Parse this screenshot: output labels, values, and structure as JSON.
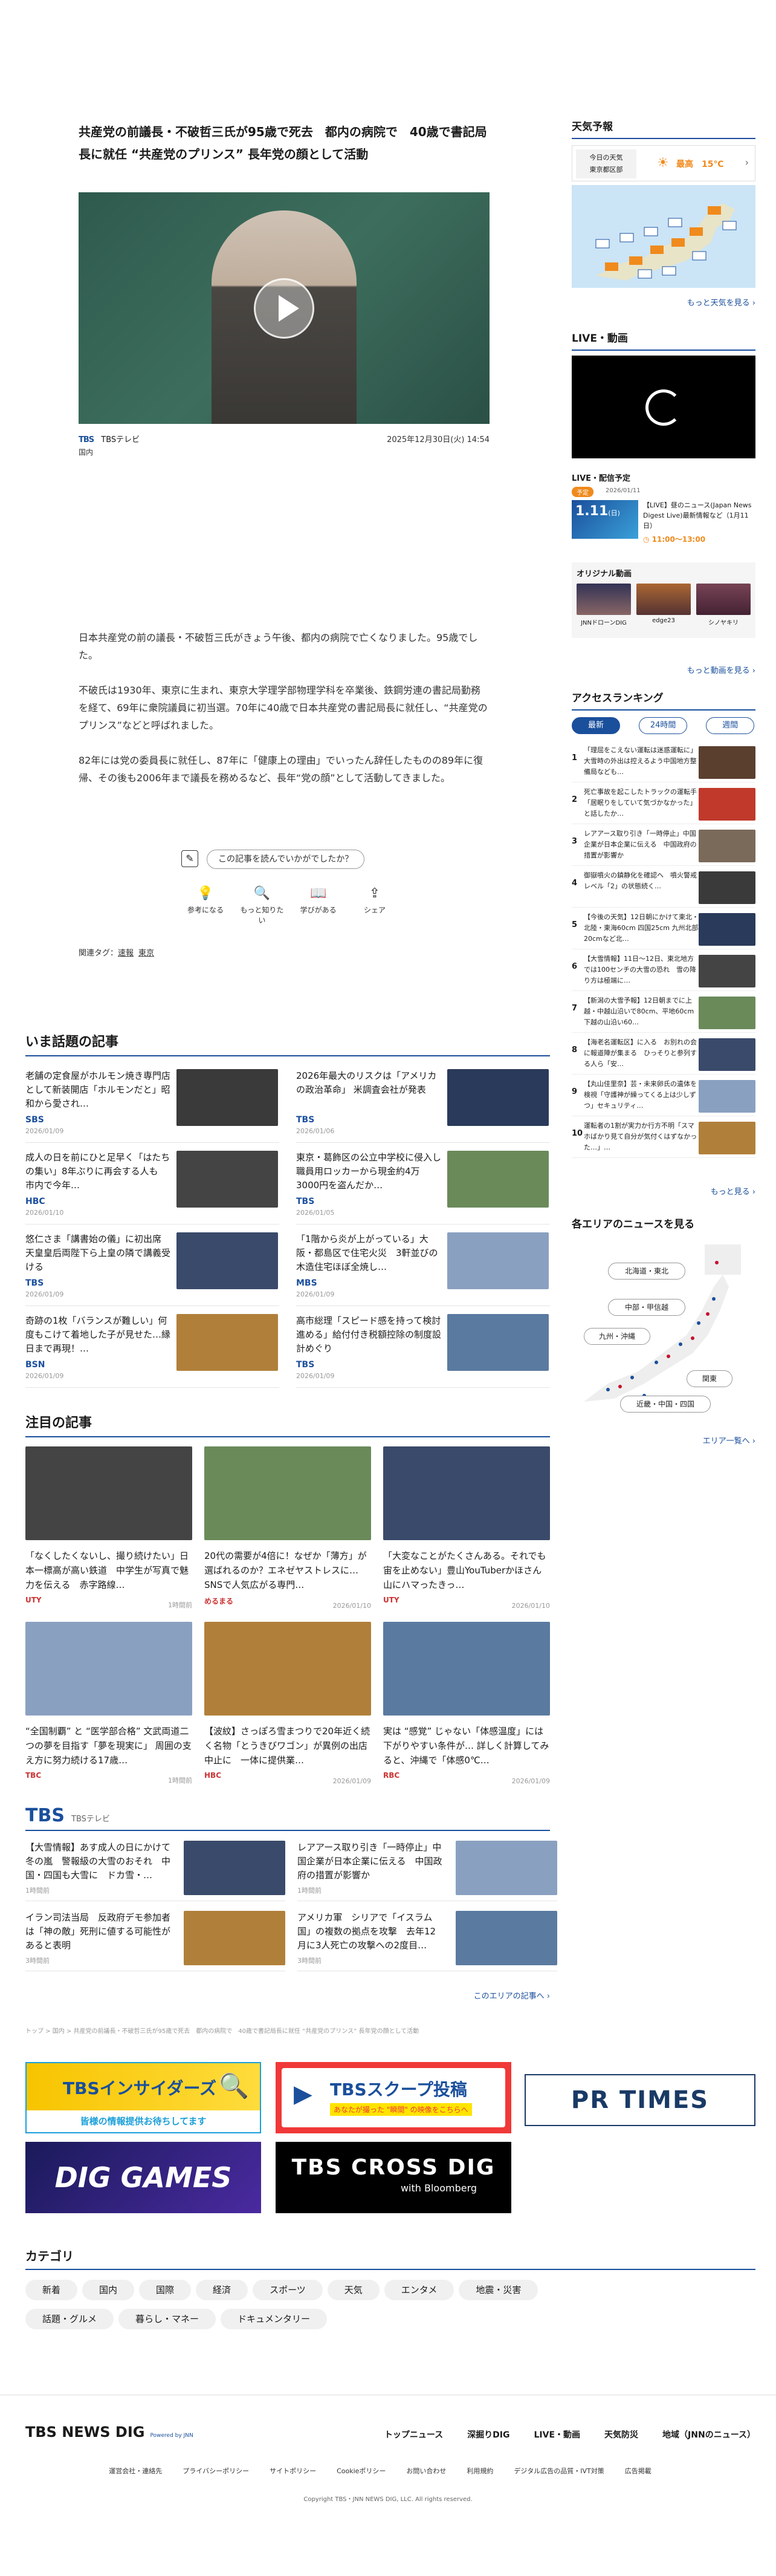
{
  "article": {
    "title": "共産党の前議長・不破哲三氏が95歳で死去　都内の病院で　40歳で書記局長に就任 “共産党のプリンス” 長年党の顔として活動",
    "source_logo": "TBS",
    "source_name": "TBSテレビ",
    "category": "国内",
    "date": "2025年12月30日(火) 14:54",
    "paragraphs": [
      "日本共産党の前の議長・不破哲三氏がきょう午後、都内の病院で亡くなりました。95歳でした。",
      "不破氏は1930年、東京に生まれ、東京大学理学部物理学科を卒業後、鉄鋼労連の書記局勤務を経て、69年に衆院議員に初当選。70年に40歳で日本共産党の書記局長に就任し、“共産党のプリンス”などと呼ばれました。",
      "82年には党の委員長に就任し、87年に「健康上の理由」でいったん辞任したものの89年に復帰、その後も2006年まで議長を務めるなど、長年“党の顔”として活動してきました。"
    ],
    "feedback_prompt": "この記事を読んでいかがでしたか？",
    "reactions": [
      "参考になる",
      "もっと知りたい",
      "学びがある",
      "シェア"
    ],
    "tags_label": "関連タグ：",
    "tags": [
      "速報",
      "東京"
    ]
  },
  "sidebar": {
    "weather_title": "天気予報",
    "weather_today": "今日の天気",
    "weather_area": "東京都区部",
    "weather_high": "最高　15℃",
    "weather_more": "もっと天気を見る",
    "live_title": "LIVE・動画",
    "live_schedule_title": "LIVE・配信予定",
    "live_badge": "予定",
    "live_date_small": "2026/01/11",
    "live_date": "1.11",
    "live_day": "(日)",
    "live_item_title": "【LIVE】昼のニュース(Japan News Digest Live)最新情報など（1月11日）",
    "live_time": "11:00～13:00",
    "original_title": "オリジナル動画",
    "original_items": [
      "JNNドローンDIG",
      "edge23",
      "シノヤキリ"
    ],
    "original_more": "もっと動画を見る",
    "ranking_title": "アクセスランキング",
    "ranking_tabs": [
      "最新",
      "24時間",
      "週間"
    ],
    "ranking": [
      "「理屈をこえない運転は迷惑運転に」大雪時の外出は控えるよう中国地方整備局なども…",
      "死亡事故を起こしたトラックの運転手「居眠りをしていて気づかなかった」と話したか…",
      "レアアース取り引き「一時停止」中国企業が日本企業に伝える　中国政府の措置が影響か",
      "御嶽噴火の鎮静化を確認へ　噴火警戒レベル「2」の状態続く…",
      "【今後の天気】12日朝にかけて東北・北陸・東海60cm 四国25cm 九州北部20cmなど北…",
      "【大雪情報】11日～12日、東北地方では100センチの大雪の恐れ　雪の降り方は極端に…",
      "【新潟の大雪予報】12日朝までに上越・中越山沿いで80cm、平地60cm 下越の山沿い60…",
      "【海老名運転区】に入る　お別れの会に報道陣が集まる　ひっそりと参列する人ら「安…",
      "【丸山佳里奈】芸・未来卵氏の遺体を検視「守護神が繰ってくる上は少しずつ」セキュリティ…",
      "運転者の1割が実力か行方不明「スマホばかり見て自分が気付くはずなかった…」…"
    ],
    "ranking_more": "もっと見る",
    "area_title": "各エリアのニュースを見る",
    "areas": [
      "北海道・東北",
      "中部・甲信越",
      "九州・沖縄",
      "関東",
      "近畿・中国・四国"
    ],
    "area_more": "エリア一覧へ"
  },
  "topics": {
    "title": "いま話題の記事",
    "items": [
      {
        "title": "老舗の定食屋がホルモン焼き専門店として新装開店「ホルモンだと」昭和から愛され…",
        "source": "SBS",
        "date": "2026/01/09"
      },
      {
        "title": "2026年最大のリスクは「アメリカの政治革命」 米調査会社が発表",
        "source": "TBS",
        "date": "2026/01/06"
      },
      {
        "title": "成人の日を前にひと足早く「はたちの集い」8年ぶりに再会する人も　市内で今年…",
        "source": "HBC",
        "date": "2026/01/10"
      },
      {
        "title": "東京・葛飾区の公立中学校に侵入し職員用ロッカーから現金約4万3000円を盗んだか…",
        "source": "TBS",
        "date": "2026/01/05"
      },
      {
        "title": "悠仁さま「講書始の儀」に初出席　天皇皇后両陛下ら上皇の隣で講義受ける",
        "source": "TBS",
        "date": "2026/01/09"
      },
      {
        "title": "「1階から炎が上がっている」大阪・都島区で住宅火災　3軒並びの木造住宅ほぼ全焼し…",
        "source": "MBS",
        "date": "2026/01/09"
      },
      {
        "title": "奇跡の1枚「バランスが難しい」何度もこけて着地した子が見せた…縁日まで再現！…",
        "source": "BSN",
        "date": "2026/01/09"
      },
      {
        "title": "高市総理「スピード感を持って検討進める」給付付き税額控除の制度設計めぐり",
        "source": "TBS",
        "date": "2026/01/09"
      }
    ]
  },
  "featured": {
    "title": "注目の記事",
    "items": [
      {
        "title": "「なくしたくないし、撮り続けたい」日本一標高が高い鉄道　中学生が写真で魅力を伝える　赤字路線…",
        "source": "UTY",
        "date": "1時間前"
      },
      {
        "title": "20代の需要が4倍に！なぜか「薄方」が選ばれるのか？エネゼヤストレスに…SNSで人気広がる専門…",
        "source": "めるまる",
        "date": "2026/01/10"
      },
      {
        "title": "「大変なことがたくさんある。それでも宙を止めない」豊山YouTuberかほさん　山にハマったきっ…",
        "source": "UTY",
        "date": "2026/01/10"
      },
      {
        "title": "“全国制覇” と “医学部合格” 文武両道二つの夢を目指す「夢を現実に」 周囲の支え方に努力続ける17歳…",
        "source": "TBC",
        "date": "1時間前"
      },
      {
        "title": "【波紋】さっぽろ雪まつりで20年近く続く名物「とうきびワゴン」が異例の出店中止に　一体に提供業…",
        "source": "HBC",
        "date": "2026/01/09"
      },
      {
        "title": "実は “感覚” じゃない「体感温度」には下がりやすい条件が… 詳しく計算してみると、沖縄で「体感0℃…",
        "source": "RBC",
        "date": "2026/01/09"
      }
    ]
  },
  "tbs_section": {
    "logo": "TBS",
    "label": "TBSテレビ",
    "items": [
      {
        "title": "【大雪情報】あす成人の日にかけて冬の嵐　警報級の大雪のおそれ　中国・四国も大雪に　ドカ雪・…",
        "date": "1時間前"
      },
      {
        "title": "レアアース取り引き「一時停止」中国企業が日本企業に伝える　中国政府の措置が影響か",
        "date": "1時間前"
      },
      {
        "title": "イラン司法当局　反政府デモ参加者は「神の敵」死刑に値する可能性があると表明",
        "date": "3時間前"
      },
      {
        "title": "アメリカ軍　シリアで「イスラム国」の複数の拠点を攻撃　去年12月に3人死亡の攻撃への2度目…",
        "date": "3時間前"
      }
    ],
    "more": "このエリアの記事へ"
  },
  "breadcrumb": "トップ > 国内 > 共産党の前議長・不破哲三氏が95歳で死去　都内の病院で　40歳で書記局長に就任 “共産党のプリンス” 長年党の顔として活動",
  "banners": {
    "insider_title": "TBSインサイダーズ",
    "insider_sub": "皆様の情報提供お待ちしてます",
    "scoop_title": "TBSスクープ投稿",
    "scoop_sub": "あなたが撮った \"瞬間\" の映像をこちらへ",
    "prtimes": "PR TIMES",
    "dig_games": "DIG GAMES",
    "crossdig_title": "TBS CROSS DIG",
    "crossdig_sub": "with Bloomberg"
  },
  "categories": {
    "title": "カテゴリ",
    "items": [
      "新着",
      "国内",
      "国際",
      "経済",
      "スポーツ",
      "天気",
      "エンタメ",
      "地震・災害",
      "話題・グルメ",
      "暮らし・マネー",
      "ドキュメンタリー"
    ]
  },
  "footer": {
    "logo": "TBS NEWS DIG",
    "powered": "Powered by JNN",
    "links": [
      "トップニュース",
      "深掘りDIG",
      "LIVE・動画",
      "天気防災",
      "地域（JNNのニュース）"
    ],
    "sub_links": [
      "運営会社・連絡先",
      "プライバシーポリシー",
      "サイトポリシー",
      "Cookieポリシー",
      "お問い合わせ",
      "利用規約",
      "デジタル広告の品質・IVT対策",
      "広告掲載"
    ],
    "copyright": "Copyright TBS・JNN NEWS DIG, LLC. All rights reserved."
  },
  "colors": {
    "accent": "#1a4f9c",
    "orange": "#f08a1c",
    "red": "#c8102e"
  }
}
